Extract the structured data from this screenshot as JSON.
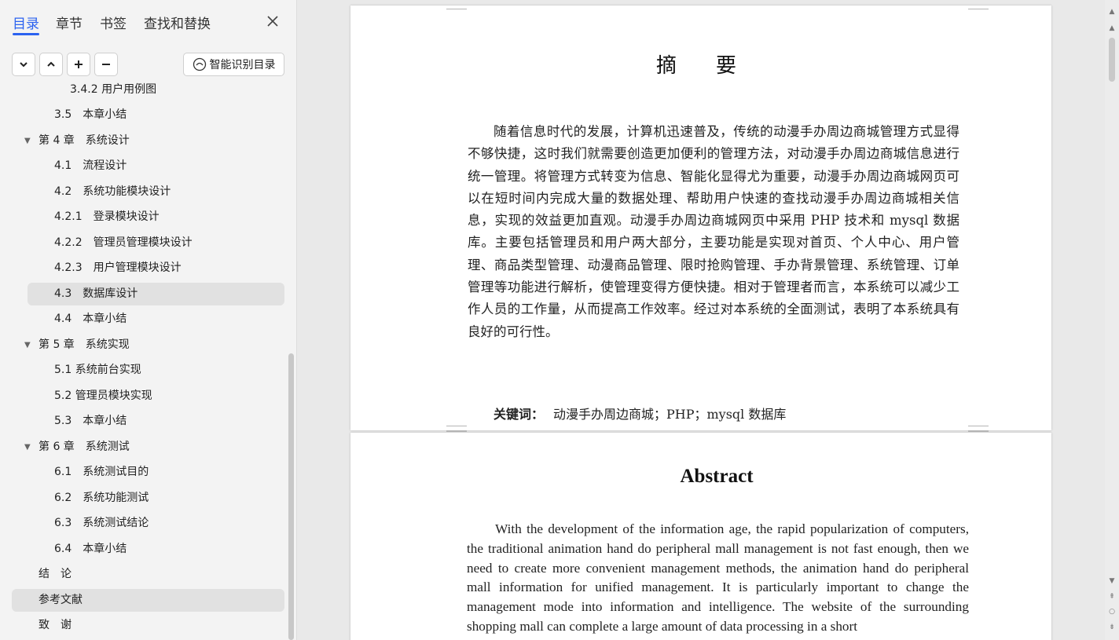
{
  "sidebar": {
    "tabs": [
      "目录",
      "章节",
      "书签",
      "查找和替换"
    ],
    "smart_toc_label": "智能识别目录",
    "toc": [
      {
        "label": "3.4.2 用户用例图"
      },
      {
        "label": "3.5　本章小结"
      },
      {
        "label": "第 4 章　系统设计"
      },
      {
        "label": "4.1　流程设计"
      },
      {
        "label": "4.2　系统功能模块设计"
      },
      {
        "label": "4.2.1　登录模块设计"
      },
      {
        "label": "4.2.2　管理员管理模块设计"
      },
      {
        "label": "4.2.3　用户管理模块设计"
      },
      {
        "label": "4.3　数据库设计"
      },
      {
        "label": "4.4　本章小结"
      },
      {
        "label": "第 5 章　系统实现"
      },
      {
        "label": "5.1 系统前台实现"
      },
      {
        "label": "5.2 管理员模块实现"
      },
      {
        "label": "5.3　本章小结"
      },
      {
        "label": "第 6 章　系统测试"
      },
      {
        "label": "6.1　系统测试目的"
      },
      {
        "label": "6.2　系统功能测试"
      },
      {
        "label": "6.3　系统测试结论"
      },
      {
        "label": "6.4　本章小结"
      },
      {
        "label": "结　论"
      },
      {
        "label": "参考文献"
      },
      {
        "label": "致　谢"
      }
    ]
  },
  "doc": {
    "page1": {
      "title": "摘　要",
      "body": "随着信息时代的发展，计算机迅速普及，传统的动漫手办周边商城管理方式显得不够快捷，这时我们就需要创造更加便利的管理方法，对动漫手办周边商城信息进行统一管理。将管理方式转变为信息、智能化显得尤为重要，动漫手办周边商城网页可以在短时间内完成大量的数据处理、帮助用户快速的查找动漫手办周边商城相关信息，实现的效益更加直观。动漫手办周边商城网页中采用 PHP 技术和 mysql 数据库。主要包括管理员和用户两大部分，主要功能是实现对首页、个人中心、用户管理、商品类型管理、动漫商品管理、限时抢购管理、手办背景管理、系统管理、订单管理等功能进行解析，使管理变得方便快捷。相对于管理者而言，本系统可以减少工作人员的工作量，从而提高工作效率。经过对本系统的全面测试，表明了本系统具有良好的可行性。",
      "keywords_label": "关键词：",
      "keywords": "动漫手办周边商城；PHP；mysql 数据库"
    },
    "page2": {
      "title": "Abstract",
      "body": "With the development of the information age, the rapid popularization of computers, the traditional animation hand do peripheral mall management is not fast enough, then we need to create more convenient management methods, the animation hand do peripheral mall information for unified management. It is particularly important to change the management mode into information and intelligence. The website of the surrounding shopping mall can complete a large amount of data processing in a short"
    }
  },
  "colors": {
    "accent": "#2b62f0",
    "selected_row": "#e1e1e1"
  }
}
